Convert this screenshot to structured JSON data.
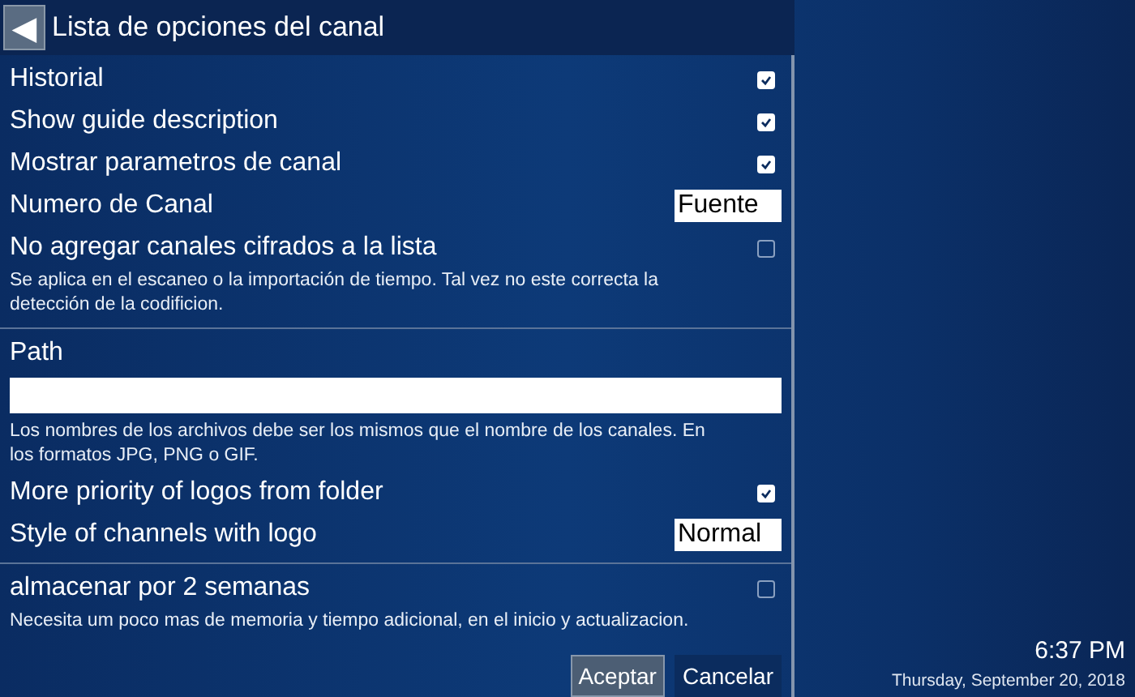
{
  "header": {
    "back": "◀",
    "title": "Lista de opciones del canal"
  },
  "sections": [
    {
      "items": [
        {
          "kind": "checkbox",
          "label": "Historial",
          "checked": true
        },
        {
          "kind": "checkbox",
          "label": "Show guide description",
          "checked": true
        },
        {
          "kind": "checkbox",
          "label": "Mostrar parametros de canal",
          "checked": true
        },
        {
          "kind": "value",
          "label": "Numero de Canal",
          "value": "Fuente"
        },
        {
          "kind": "checkbox",
          "label": "No agregar canales cifrados a la lista",
          "checked": false,
          "description": "Se aplica en el escaneo o la importación de tiempo. Tal vez no este correcta la detección de la codificion."
        }
      ]
    },
    {
      "items": [
        {
          "kind": "path",
          "label": "Path",
          "description": "Los nombres de los archivos debe ser los mismos que el nombre de los canales. En los formatos JPG, PNG o GIF."
        },
        {
          "kind": "checkbox",
          "label": "More priority of logos from folder",
          "checked": true
        },
        {
          "kind": "value",
          "label": "Style of channels with logo",
          "value": "Normal"
        }
      ]
    },
    {
      "items": [
        {
          "kind": "checkbox",
          "label": "almacenar por 2 semanas",
          "checked": false,
          "description": "Necesita um poco mas de memoria y tiempo adicional, en el inicio y actualizacion."
        }
      ]
    }
  ],
  "buttons": [
    {
      "label": "Aceptar",
      "selected": true
    },
    {
      "label": "Cancelar",
      "selected": false
    }
  ],
  "clock": {
    "time": "6:37 PM",
    "date": "Thursday, September 20, 2018"
  }
}
